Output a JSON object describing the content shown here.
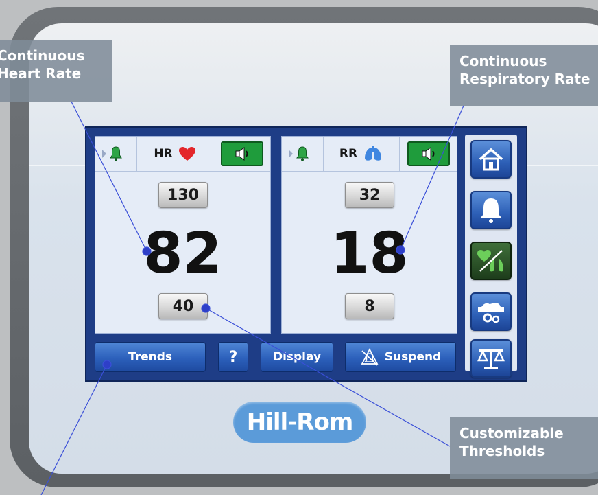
{
  "device": {
    "brand": "Hill-Rom"
  },
  "panels": {
    "hr": {
      "label": "HR",
      "upper_threshold": "130",
      "value": "82",
      "lower_threshold": "40"
    },
    "rr": {
      "label": "RR",
      "upper_threshold": "32",
      "value": "18",
      "lower_threshold": "8"
    }
  },
  "toolbar": {
    "trends_label": "Trends",
    "help_label": "?",
    "display_label": "Display",
    "suspend_label": "Suspend"
  },
  "sidebar": {
    "items": [
      {
        "icon": "home-icon"
      },
      {
        "icon": "bell-icon"
      },
      {
        "icon": "heart-lungs-icon"
      },
      {
        "icon": "bed-settings-icon"
      },
      {
        "icon": "scale-icon"
      }
    ]
  },
  "callouts": {
    "heart_rate": {
      "line1": "Continuous",
      "line2": "Heart Rate"
    },
    "respiratory_rate": {
      "line1": "Continuous",
      "line2": "Respiratory Rate"
    },
    "thresholds": {
      "line1": "Customizable",
      "line2": "Thresholds"
    }
  },
  "colors": {
    "screen_blue": "#1e3d86",
    "speaker_green": "#1f9c3c",
    "heart_red": "#e3262b",
    "lungs_blue": "#3f86e0",
    "callout_gray": "#808c98"
  }
}
